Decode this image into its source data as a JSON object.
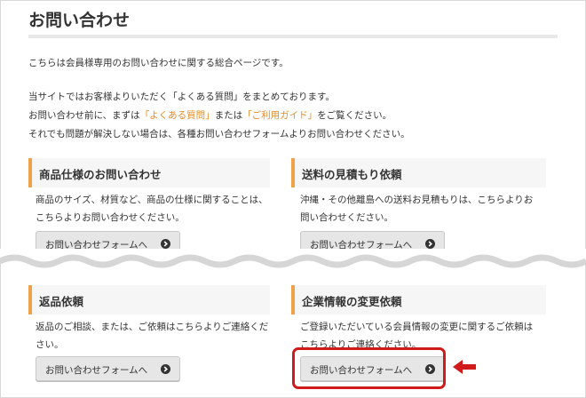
{
  "page": {
    "title": "お問い合わせ",
    "intro": [
      "こちらは会員様専用のお問い合わせに関する総合ページです。",
      "当サイトではお客様よりいただく「よくある質問」をまとめております。"
    ],
    "intro_line3": {
      "pre": "お問い合わせ前に、まずは",
      "link1": "「よくある質問」",
      "mid": "または",
      "link2": "「ご利用ガイド」",
      "post": "をご覧ください。"
    },
    "intro_line4": "それでも問題が解決しない場合は、各種お問い合わせフォームよりお問い合わせください。"
  },
  "cards": [
    {
      "title": "商品仕様のお問い合わせ",
      "lines": [
        "商品のサイズ、材質など、商品の仕様に関することは、",
        "こちらよりお問い合わせください。"
      ],
      "button": "お問い合わせフォームへ"
    },
    {
      "title": "送料の見積もり依頼",
      "lines": [
        "沖縄・その他離島への送料お見積もりは、こちらよりお",
        "問い合わせください。"
      ],
      "button": "お問い合わせフォームへ"
    },
    {
      "title": "返品依頼",
      "lines": [
        "返品のご相談、または、ご依頼はこちらよりご連絡くだ",
        "さい。"
      ],
      "button": "お問い合わせフォームへ"
    },
    {
      "title": "企業情報の変更依頼",
      "lines": [
        "ご登録いただいている会員情報の変更に関するご依頼は",
        "こちらよりご連絡ください。"
      ],
      "button": "お問い合わせフォームへ"
    }
  ],
  "colors": {
    "accent": "#f0a24a",
    "link": "#e8891d",
    "highlight": "#d11a1a"
  },
  "icons": {
    "button_arrow": "chevron-circle-right-icon",
    "pointer": "red-arrow-left-icon"
  }
}
